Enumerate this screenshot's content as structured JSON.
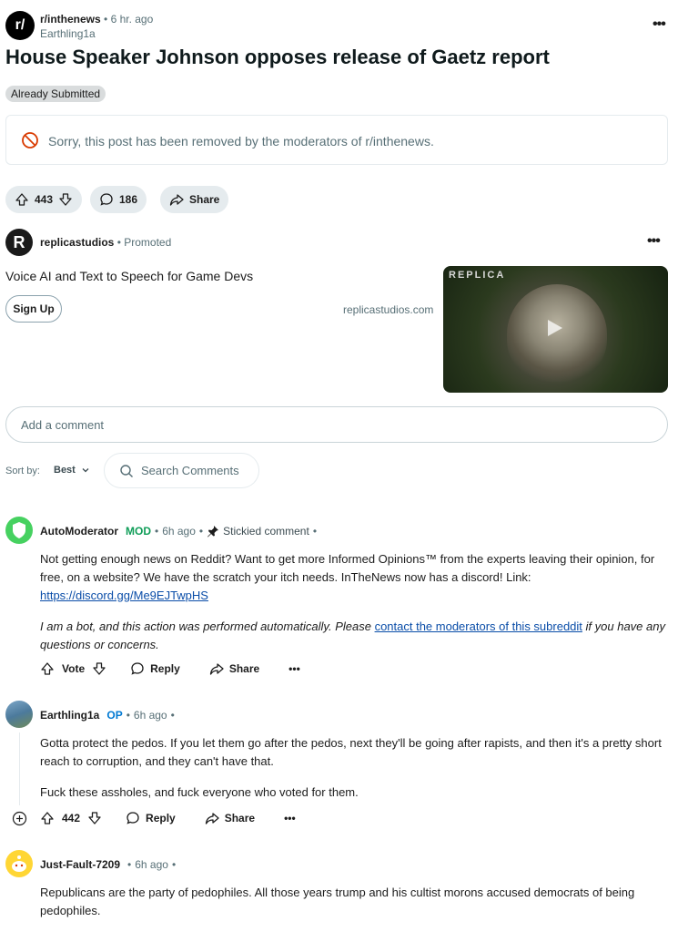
{
  "post": {
    "subreddit": "r/inthenews",
    "age": "6 hr. ago",
    "author": "Earthling1a",
    "title": "House Speaker Johnson opposes release of Gaetz report",
    "flair": "Already Submitted",
    "removed_notice": "Sorry, this post has been removed by the moderators of r/inthenews.",
    "score": "443",
    "comment_count": "186",
    "share_label": "Share",
    "menu": "•••"
  },
  "ad": {
    "advertiser": "replicastudios",
    "tag": "Promoted",
    "headline": "Voice AI and Text to Speech for Game Devs",
    "cta": "Sign Up",
    "domain": "replicastudios.com",
    "image_logo": "REPLICA",
    "menu": "•••"
  },
  "comment_box": {
    "placeholder": "Add a comment"
  },
  "sort": {
    "label": "Sort by:",
    "value": "Best",
    "search_placeholder": "Search Comments"
  },
  "comments": [
    {
      "user": "AutoModerator",
      "badge": "MOD",
      "age": "6h ago",
      "stickied": "Stickied comment",
      "body1": "Not getting enough news on Reddit? Want to get more Informed Opinions™ from the experts leaving their opinion, for free, on a website? We have the scratch your itch needs. InTheNews now has a discord! Link:",
      "link": "https://discord.gg/Me9EJTwpHS",
      "body2_pre": "I am a bot, and this action was performed automatically. Please ",
      "body2_link": "contact the moderators of this subreddit",
      "body2_post": " if you have any questions or concerns.",
      "vote_label": "Vote",
      "reply_label": "Reply",
      "share_label": "Share"
    },
    {
      "user": "Earthling1a",
      "badge": "OP",
      "age": "6h ago",
      "body1": "Gotta protect the pedos. If you let them go after the pedos, next they'll be going after rapists, and then it's a pretty short reach to corruption, and they can't have that.",
      "body2": "Fuck these assholes, and fuck everyone who voted for them.",
      "score": "442",
      "reply_label": "Reply",
      "share_label": "Share"
    },
    {
      "user": "Just-Fault-7209",
      "age": "6h ago",
      "body1": "Republicans are the party of pedophiles.  All those years trump and his cultist morons accused democrats of being pedophiles."
    }
  ],
  "colors": {
    "mod_green": "#0f9d58",
    "op_blue": "#0079d3",
    "link_blue": "#0a4da8",
    "removed_red": "#d93a00"
  }
}
